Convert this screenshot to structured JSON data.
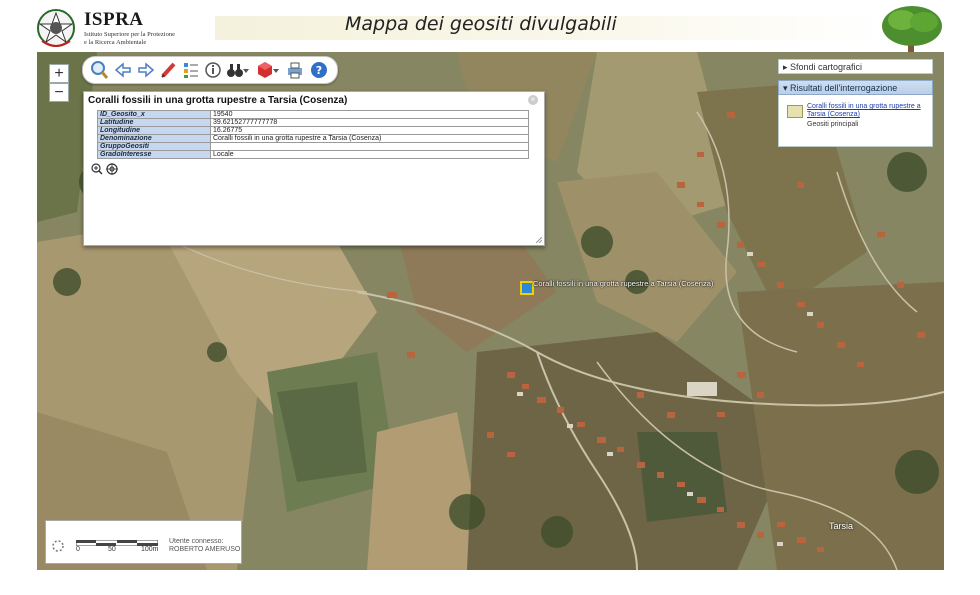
{
  "header": {
    "logo": "ISPRA",
    "logo_sub_1": "Istituto Superiore per la Protezione",
    "logo_sub_2": "e la Ricerca Ambientale",
    "title": "Mappa dei geositi divulgabili"
  },
  "map_controls": {
    "zoom_in": "+",
    "zoom_out": "−"
  },
  "toolbar": {
    "icons": [
      "zoom-search-icon",
      "back-arrow-icon",
      "forward-arrow-icon",
      "measure-pencil-icon",
      "legend-icon",
      "info-icon",
      "binoculars-icon",
      "layers-cube-icon",
      "print-icon",
      "help-icon"
    ]
  },
  "right_panel": {
    "basemaps": "▸ Sfondi cartografici",
    "results": "▾ Risultati dell'interrogazione",
    "result_link": "Coralli fossili in una grotta rupestre a Tarsia (Cosenza)",
    "result_sub": "Geositi principali"
  },
  "popup": {
    "title": "Coralli fossili in una grotta rupestre a Tarsia (Cosenza)",
    "rows": [
      {
        "key": "ID_Geosito_x",
        "value": "19540"
      },
      {
        "key": "Latitudine",
        "value": "39.62152777777778"
      },
      {
        "key": "Longitudine",
        "value": "16.26775"
      },
      {
        "key": "Denominazione",
        "value": "Coralli fossili in una grotta rupestre a Tarsia (Cosenza)"
      },
      {
        "key": "GruppoGeositi",
        "value": ""
      },
      {
        "key": "GradoInteresse",
        "value": "Locale"
      }
    ]
  },
  "map": {
    "marker_label": "Coralli fossili in una grotta rupestre a Tarsia (Cosenza)",
    "place": "Tarsia"
  },
  "status": {
    "scale_0": "0",
    "scale_50": "50",
    "scale_100": "100m",
    "user_label": "Utente connesso:",
    "user_name": "ROBERTO AMERUSO"
  },
  "colors": {
    "panel_header": "#b9cfe8",
    "table_key": "#c6d8ef",
    "link": "#1a3ea8",
    "marker": "#2a8ad8"
  }
}
